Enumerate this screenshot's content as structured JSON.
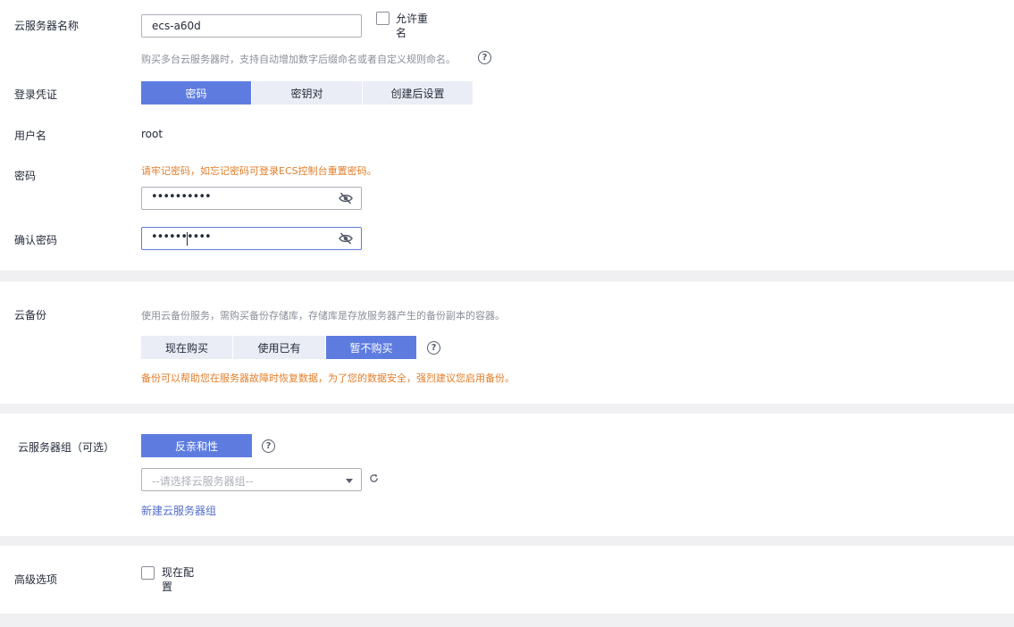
{
  "instance": {
    "name_label": "云服务器名称",
    "name_value": "ecs-a60d",
    "allow_duplicate_label": "允许重名",
    "name_hint": "购买多台云服务器时，支持自动增加数字后缀命名或者自定义规则命名。"
  },
  "login": {
    "label": "登录凭证",
    "options": [
      "密码",
      "密钥对",
      "创建后设置"
    ],
    "selected": "密码",
    "username_label": "用户名",
    "username_value": "root",
    "password_label": "密码",
    "password_warning": "请牢记密码，如忘记密码可登录ECS控制台重置密码。",
    "password_mask": "••••••••••",
    "confirm_label": "确认密码",
    "confirm_mask": "••••••••••"
  },
  "backup": {
    "label": "云备份",
    "desc": "使用云备份服务，需购买备份存储库，存储库是存放服务器产生的备份副本的容器。",
    "options": [
      "现在购买",
      "使用已有",
      "暂不购买"
    ],
    "selected": "暂不购买",
    "warning": "备份可以帮助您在服务器故障时恢复数据，为了您的数据安全，强烈建议您启用备份。"
  },
  "server_group": {
    "label": "云服务器组（可选）",
    "policy_button": "反亲和性",
    "select_placeholder": "--请选择云服务器组--",
    "create_link": "新建云服务器组"
  },
  "advanced": {
    "label": "高级选项",
    "configure_now_label": "现在配置"
  },
  "colors": {
    "primary": "#5e7ce0",
    "warning": "#e37d29",
    "link": "#526ecc",
    "segment_bg": "#eaedf5"
  }
}
